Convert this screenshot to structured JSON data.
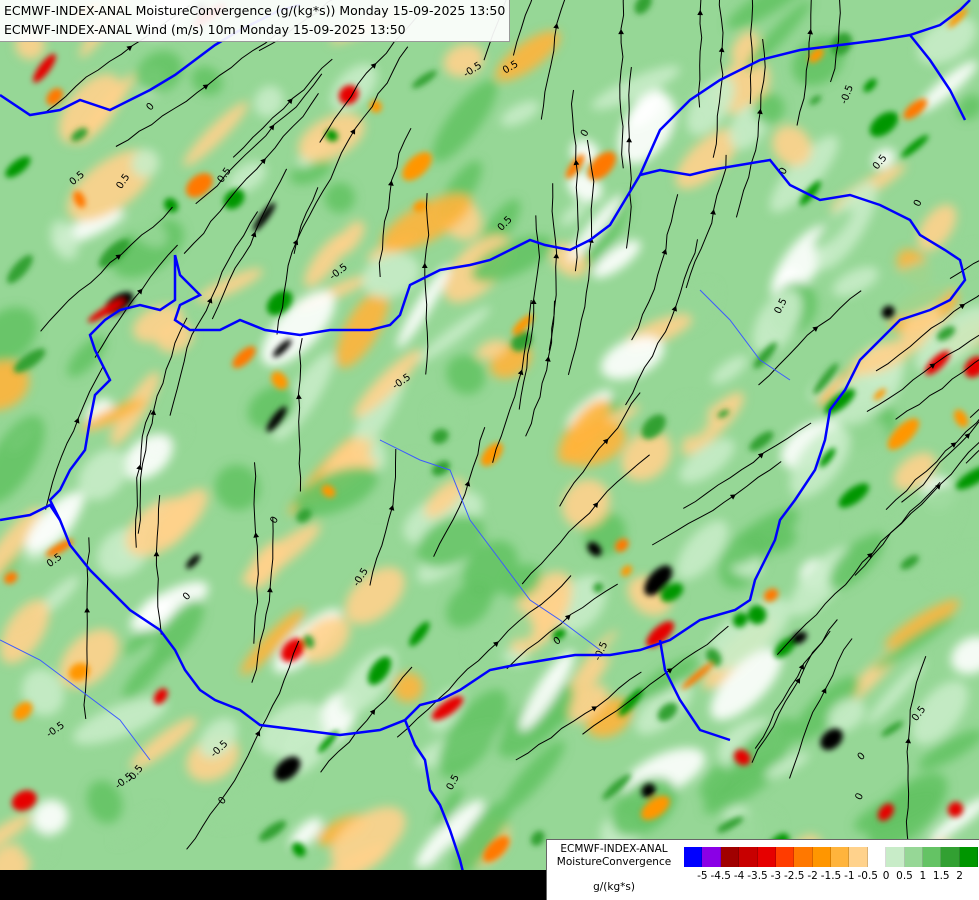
{
  "header": {
    "line1": "ECMWF-INDEX-ANAL MoistureConvergence (g/(kg*s)) Monday 15-09-2025 13:50",
    "line2": "ECMWF-INDEX-ANAL Wind (m/s) 10m Monday 15-09-2025 13:50"
  },
  "legend": {
    "title_line1": "ECMWF-INDEX-ANAL",
    "title_line2": "MoistureConvergence",
    "units": "g/(kg*s)",
    "ticks": [
      "-5",
      "-4.5",
      "-4",
      "-3.5",
      "-3",
      "-2.5",
      "-2",
      "-1.5",
      "-1",
      "-0.5",
      "0",
      "0.5",
      "1",
      "1.5",
      "2"
    ],
    "colors": [
      "#0000ff",
      "#8a00e6",
      "#a00000",
      "#c80000",
      "#e60000",
      "#ff3c00",
      "#ff7800",
      "#ff9600",
      "#ffb43c",
      "#ffd28c",
      "#ffffff",
      "#c8ecc8",
      "#96d796",
      "#64c364",
      "#32a032",
      "#009600"
    ]
  },
  "contour_labels": [
    "0.5",
    "-0.5",
    "0",
    "0.5",
    "-0.5",
    "0",
    "0.5",
    "-0.5",
    "0",
    "0.5",
    "-0.5",
    "0",
    "0.5",
    "-0.5",
    "0",
    "0.5",
    "-0.5",
    "0",
    "0.5",
    "-0.5",
    "0",
    "0.5",
    "-0.5",
    "0",
    "0.5",
    "-0.5",
    "0",
    "0.5",
    "-0.5",
    "0"
  ],
  "colors": {
    "border": "#0000ff",
    "streamline": "#000000",
    "bottom_bar": "#000000"
  }
}
